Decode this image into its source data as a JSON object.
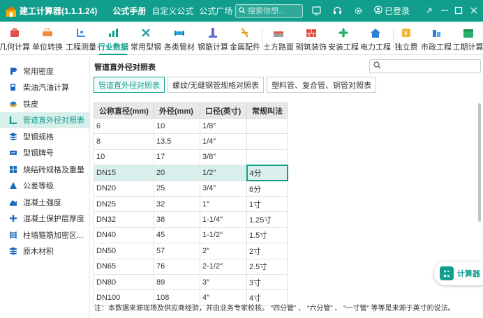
{
  "app": {
    "title": "建工计算器(1.1.1.24)"
  },
  "top_tabs": [
    "公式手册",
    "自定义公式",
    "公式广场"
  ],
  "search": {
    "placeholder": "搜索你想..."
  },
  "account": {
    "login_label": "已登录"
  },
  "toolbar": [
    "几何计算",
    "单位转换",
    "工程测量",
    "行业数据",
    "常用型钢",
    "各类管材",
    "钢筋计算",
    "金属配件",
    "土方路面",
    "砌筑装饰",
    "安装工程",
    "电力工程",
    "独立费",
    "市政工程",
    "工期计算"
  ],
  "toolbar_active": "行业数据",
  "sidebar": [
    "常用密度",
    "柴油汽油计算",
    "铁皮",
    "管道直外径对照表",
    "型钢规格",
    "型钢牌号",
    "烧结砖规格及重量",
    "公差等级",
    "混凝土强度",
    "混凝土保护层厚度",
    "柱墙箍筋加密区...",
    "原木材积"
  ],
  "sidebar_active": "管道直外径对照表",
  "main": {
    "title": "管道直外径对照表",
    "sub_tabs": [
      "管道直外径对照表",
      "螺纹/无缝钢管规格对照表",
      "塑料管、复合管、铜管对照表"
    ],
    "table": {
      "headers": [
        "公称直径(mm)",
        "外径(mm)",
        "口径(英寸)",
        "常规叫法"
      ],
      "rows": [
        [
          "6",
          "10",
          "1/8″",
          ""
        ],
        [
          "8",
          "13.5",
          "1/4″",
          ""
        ],
        [
          "10",
          "17",
          "3/8″",
          ""
        ],
        [
          "DN15",
          "20",
          "1/2″",
          "4分"
        ],
        [
          "DN20",
          "25",
          "3/4″",
          "6分"
        ],
        [
          "DN25",
          "32",
          "1″",
          "1寸"
        ],
        [
          "DN32",
          "38",
          "1-1/4″",
          "1.25寸"
        ],
        [
          "DN40",
          "45",
          "1-1/2″",
          "1.5寸"
        ],
        [
          "DN50",
          "57",
          "2″",
          "2寸"
        ],
        [
          "DN65",
          "76",
          "2-1/2″",
          "2.5寸"
        ],
        [
          "DN80",
          "89",
          "3″",
          "3寸"
        ],
        [
          "DN100",
          "108",
          "4″",
          "4寸"
        ]
      ]
    },
    "note": "注：本数据来源现场及供应商经验，并由业务专家校核。 “四分管” 、 “六分管” 、 “一寸管” 等等是来源于英寸的说法。"
  },
  "calculator_label": "计算器",
  "colors": {
    "brand": "#129e8c",
    "selected_row": "#d9efec"
  }
}
